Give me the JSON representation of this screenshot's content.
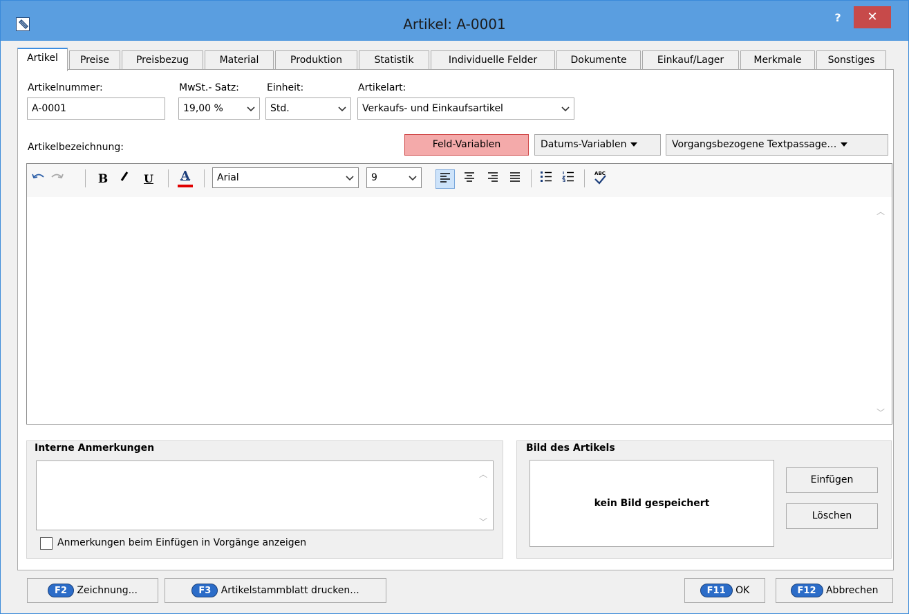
{
  "window": {
    "title": "Artikel: A-0001",
    "help_label": "?",
    "close_label": "✕"
  },
  "tabs": [
    {
      "label": "Artikel",
      "active": true
    },
    {
      "label": "Preise"
    },
    {
      "label": "Preisbezug"
    },
    {
      "label": "Material"
    },
    {
      "label": "Produktion"
    },
    {
      "label": "Statistik"
    },
    {
      "label": "Individuelle Felder"
    },
    {
      "label": "Dokumente"
    },
    {
      "label": "Einkauf/Lager"
    },
    {
      "label": "Merkmale"
    },
    {
      "label": "Sonstiges"
    }
  ],
  "fields": {
    "artikelnummer_label": "Artikelnummer:",
    "artikelnummer_value": "A-0001",
    "mwst_label": "MwSt.- Satz:",
    "mwst_value": "19,00 %",
    "einheit_label": "Einheit:",
    "einheit_value": "Std.",
    "artikelart_label": "Artikelart:",
    "artikelart_value": "Verkaufs- und Einkaufsartikel",
    "bezeichnung_label": "Artikelbezeichnung:"
  },
  "variable_buttons": {
    "feld": "Feld-Variablen",
    "datum": "Datums-Variablen",
    "textpassage": "Vorgangsbezogene Textpassage…"
  },
  "toolbar": {
    "font_value": "Arial",
    "size_value": "9",
    "bold_glyph": "B",
    "underline_glyph": "U",
    "color_glyph": "A",
    "spell_glyph": "ABC"
  },
  "notes": {
    "title": "Interne Anmerkungen",
    "checkbox_label": "Anmerkungen beim Einfügen in Vorgänge anzeigen",
    "checked": false
  },
  "image": {
    "title": "Bild des Artikels",
    "empty_text": "kein Bild gespeichert",
    "insert_label": "Einfügen",
    "delete_label": "Löschen"
  },
  "footer": {
    "drawing_key": "F2",
    "drawing_label": "Zeichnung...",
    "print_key": "F3",
    "print_label": "Artikelstammblatt drucken...",
    "ok_key": "F11",
    "ok_label": "OK",
    "cancel_key": "F12",
    "cancel_label": "Abbrechen"
  },
  "colors": {
    "titlebar": "#5a9ee0",
    "close": "#c74a4a",
    "feld_button": "#f4aaaa",
    "fkey_badge": "#2b6cc8",
    "text_color_underline": "#e00000"
  }
}
